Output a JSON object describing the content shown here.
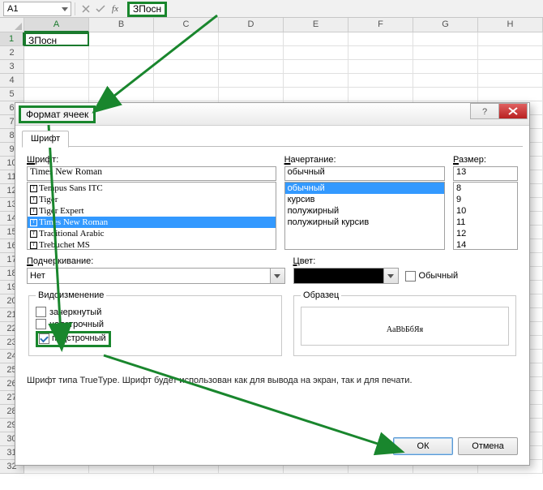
{
  "formula_bar": {
    "name_box": "A1",
    "formula_value": "ЗПосн"
  },
  "columns": [
    "A",
    "B",
    "C",
    "D",
    "E",
    "F",
    "G",
    "H"
  ],
  "active_cell_value": "ЗПосн",
  "dialog": {
    "title": "Формат ячеек",
    "tab": "Шрифт",
    "font": {
      "label": "Шрифт:",
      "value": "Times New Roman",
      "list": [
        "Tempus Sans ITC",
        "Tiger",
        "Tiger Expert",
        "Times New Roman",
        "Traditional Arabic",
        "Trebuchet MS"
      ],
      "selected": "Times New Roman"
    },
    "style": {
      "label": "Начертание:",
      "value": "обычный",
      "list": [
        "обычный",
        "курсив",
        "полужирный",
        "полужирный курсив"
      ],
      "selected": "обычный"
    },
    "size": {
      "label": "Размер:",
      "value": "13",
      "list": [
        "8",
        "9",
        "10",
        "11",
        "12",
        "14"
      ]
    },
    "underline": {
      "label": "Подчеркивание:",
      "value": "Нет"
    },
    "color": {
      "label": "Цвет:",
      "normal_label": "Обычный",
      "normal_checked": false
    },
    "effects": {
      "label": "Видоизменение",
      "strike": {
        "label": "зачеркнутый",
        "checked": false
      },
      "super": {
        "label": "надстрочный",
        "checked": false
      },
      "sub": {
        "label": "подстрочный",
        "checked": true
      }
    },
    "sample": {
      "label": "Образец",
      "text": "АаВbБбЯя"
    },
    "hint": "Шрифт типа TrueType. Шрифт будет использован как для вывода на экран, так и для печати.",
    "ok": "ОК",
    "cancel": "Отмена"
  }
}
